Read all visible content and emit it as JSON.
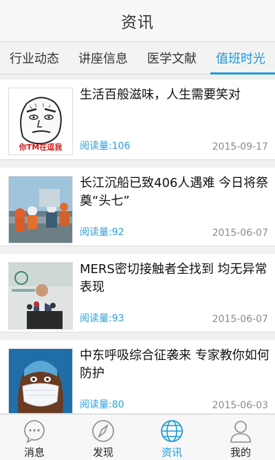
{
  "header": {
    "title": "资讯"
  },
  "tabs": [
    {
      "label": "行业动态",
      "active": false
    },
    {
      "label": "讲座信息",
      "active": false
    },
    {
      "label": "医学文献",
      "active": false
    },
    {
      "label": "值班时光",
      "active": true
    }
  ],
  "articles": [
    {
      "title": "生活百般滋味，人生需要笑对",
      "reads": "阅读量:106",
      "date": "2015-09-17",
      "thumb_caption": "你TM在逗我"
    },
    {
      "title": "长江沉船已致406人遇难 今日将祭奠“头七”",
      "reads": "阅读量:92",
      "date": "2015-06-07"
    },
    {
      "title": "MERS密切接触者全找到 均无异常表现",
      "reads": "阅读量:93",
      "date": "2015-06-07"
    },
    {
      "title": "中东呼吸综合征袭来 专家教你如何防护",
      "reads": "阅读量:80",
      "date": "2015-06-03"
    }
  ],
  "bottom_nav": [
    {
      "label": "消息",
      "icon": "message-icon",
      "active": false
    },
    {
      "label": "发现",
      "icon": "compass-icon",
      "active": false
    },
    {
      "label": "资讯",
      "icon": "globe-icon",
      "active": true
    },
    {
      "label": "我的",
      "icon": "user-icon",
      "active": false
    }
  ],
  "colors": {
    "accent": "#1a9ad6",
    "reads": "#2a9fd8",
    "date": "#8a8a8a"
  }
}
